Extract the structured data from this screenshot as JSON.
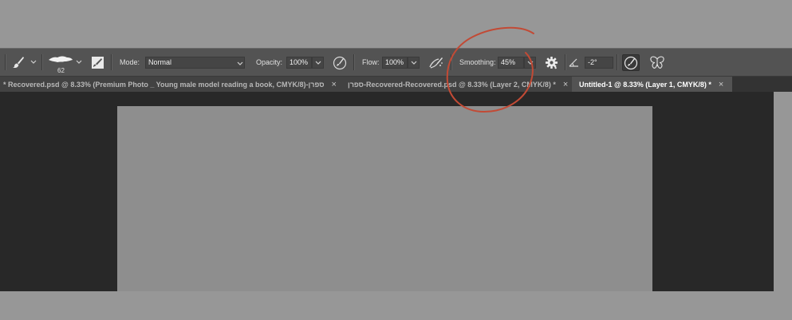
{
  "options_bar": {
    "brush_size": "62",
    "mode_label": "Mode:",
    "mode_value": "Normal",
    "opacity_label": "Opacity:",
    "opacity_value": "100%",
    "flow_label": "Flow:",
    "flow_value": "100%",
    "smoothing_label": "Smoothing:",
    "smoothing_value": "45%",
    "angle_value": "-2°"
  },
  "tabs": [
    {
      "label": "ספרן-Recovered.psd @ 8.33% (Premium Photo _ Young male model reading a book, CMYK/8) *",
      "close": "×",
      "active": false
    },
    {
      "label": "ספרן-Recovered-Recovered.psd @ 8.33% (Layer 2, CMYK/8) *",
      "close": "×",
      "active": false
    },
    {
      "label": "Untitled-1 @ 8.33% (Layer 1, CMYK/8) *",
      "close": "×",
      "active": true
    }
  ],
  "colors": {
    "app_background": "#979797",
    "options_bar": "#535353",
    "tab_bar": "#424242",
    "active_tab": "#535353",
    "workspace": "#282828",
    "canvas": "#8e8e8e",
    "annotation_circle": "#c24a35"
  },
  "icons": [
    "brush-tool-icon",
    "brush-preset-icon",
    "brush-settings-panel-icon",
    "pressure-opacity-icon",
    "airbrush-icon",
    "smoothing-settings-gear-icon",
    "angle-icon",
    "pressure-size-icon",
    "symmetry-butterfly-icon",
    "close-icon"
  ]
}
